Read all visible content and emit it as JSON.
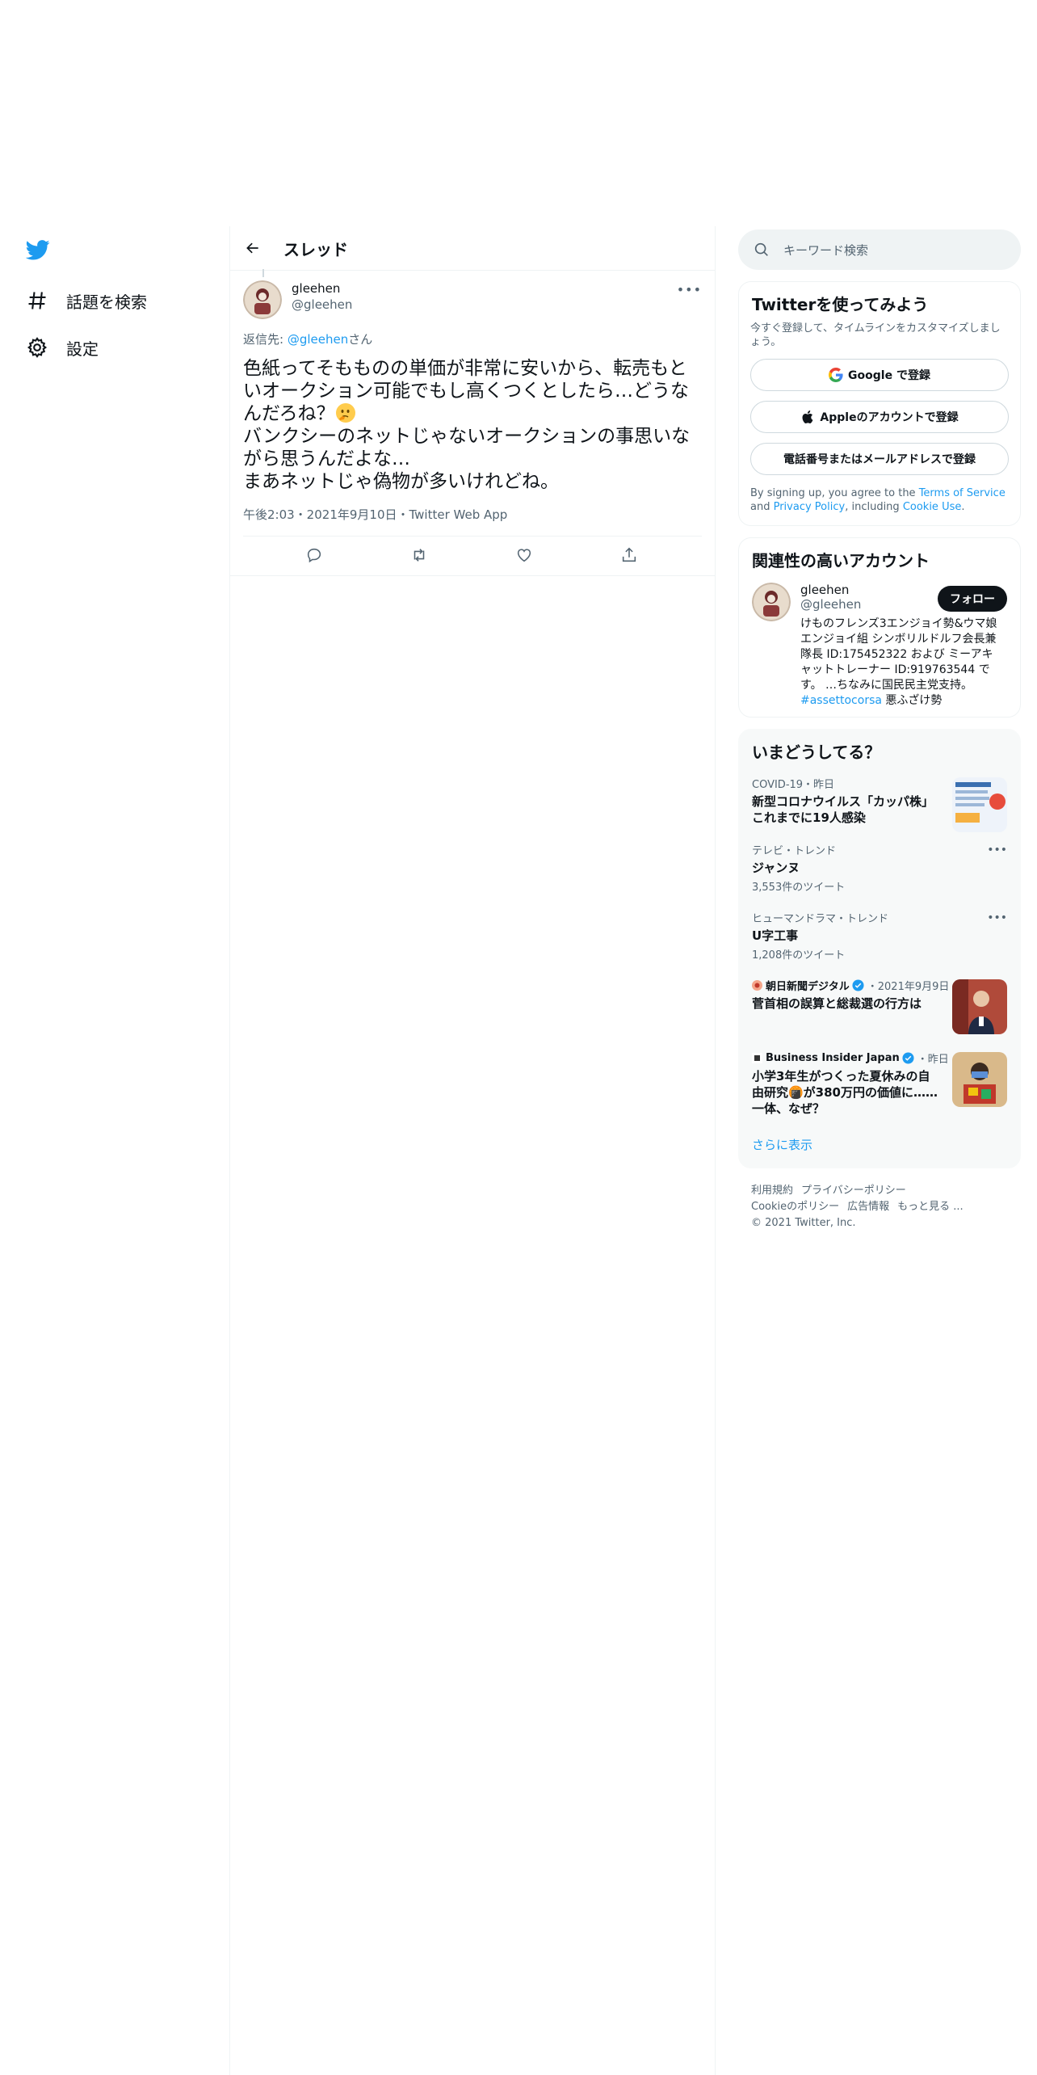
{
  "sidebar": {
    "logo": "twitter-bird-icon",
    "items": [
      {
        "label": "話題を検索",
        "icon": "hashtag-icon"
      },
      {
        "label": "設定",
        "icon": "gear-icon"
      }
    ]
  },
  "main": {
    "title": "スレッド",
    "tweet": {
      "author_name": "gleehen",
      "author_handle": "@gleehen",
      "reply_prefix": "返信先: ",
      "reply_handle": "@gleehen",
      "reply_suffix": "さん",
      "text_line1": "色紙ってそもものの単価が非常に安いから、転売もといオークション可能でもし高くつくとしたら…どうなんだろね？",
      "text_line2": "バンクシーのネットじゃないオークションの事思いながら思うんだよな…",
      "text_line3": "まあネットじゃ偽物が多いけれどね。",
      "meta": "午後2:03・2021年9月10日・Twitter Web App"
    }
  },
  "search": {
    "placeholder": "キーワード検索"
  },
  "signup": {
    "title": "Twitterを使ってみよう",
    "subtitle": "今すぐ登録して、タイムラインをカスタマイズしましょう。",
    "google": "Google で登録",
    "apple": "Appleのアカウントで登録",
    "phone": "電話番号またはメールアドレスで登録",
    "terms_prefix": "By signing up, you agree to the ",
    "terms_link": "Terms of Service",
    "terms_mid": " and ",
    "privacy_link": "Privacy Policy",
    "terms_mid2": ", including ",
    "cookie_link": "Cookie Use",
    "terms_end": "."
  },
  "related": {
    "title": "関連性の高いアカウント",
    "name": "gleehen",
    "handle": "@gleehen",
    "follow": "フォロー",
    "bio": "けものフレンズ3エンジョイ勢&ウマ娘エンジョイ組 シンボリルドルフ会長兼隊長 ID:175452322 および ミーアキャットトレーナー ID:919763544 です。 …ちなみに国民民主党支持。",
    "bio_tag": "#assettocorsa",
    "bio_end": " 悪ふざけ勢"
  },
  "trends": {
    "title": "いまどうしてる？",
    "items": [
      {
        "meta": "COVID-19・昨日",
        "title": "新型コロナウイルス「カッパ株」 これまでに19人感染"
      },
      {
        "meta": "テレビ・トレンド",
        "title": "ジャンヌ",
        "count": "3,553件のツイート"
      },
      {
        "meta": "ヒューマンドラマ・トレンド",
        "title": "U字工事",
        "count": "1,208件のツイート"
      },
      {
        "source": "朝日新聞デジタル",
        "date": "・2021年9月9日",
        "title": "菅首相の誤算と総裁選の行方は"
      },
      {
        "source": "Business Insider Japan",
        "date": "・昨日",
        "title": "小学3年生がつくった夏休みの自由研究🍘が380万円の価値に……一体、なぜ？"
      }
    ],
    "show_more": "さらに表示"
  },
  "footer": {
    "terms": "利用規約",
    "privacy": "プライバシーポリシー",
    "cookie": "Cookieのポリシー",
    "ads": "広告情報",
    "more": "もっと見る ...",
    "copyright": "© 2021 Twitter, Inc."
  },
  "colors": {
    "accent": "#1d9bf0",
    "text": "#0f1419",
    "secondary": "#536471",
    "border": "#eff3f4"
  }
}
